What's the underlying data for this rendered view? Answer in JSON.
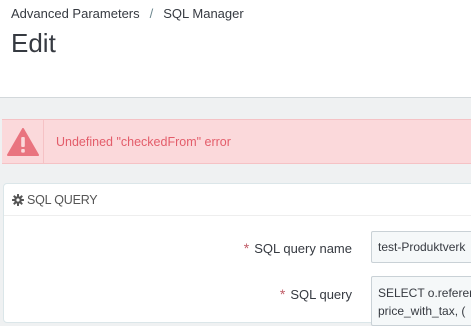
{
  "breadcrumb": {
    "parent": "Advanced Parameters",
    "separator": "/",
    "current": "SQL Manager"
  },
  "page_title": "Edit",
  "alert": {
    "icon": "warning-icon",
    "message": "Undefined \"checkedFrom\" error",
    "color": "#e35d6a"
  },
  "panel": {
    "icon": "gear-icon",
    "title": "SQL QUERY"
  },
  "form": {
    "required_marker": "*",
    "name_label": "SQL query name",
    "name_value": "test-Produktverk",
    "query_label": "SQL query",
    "query_value_line1": "SELECT o.referer",
    "query_value_line2": "price_with_tax, ("
  }
}
